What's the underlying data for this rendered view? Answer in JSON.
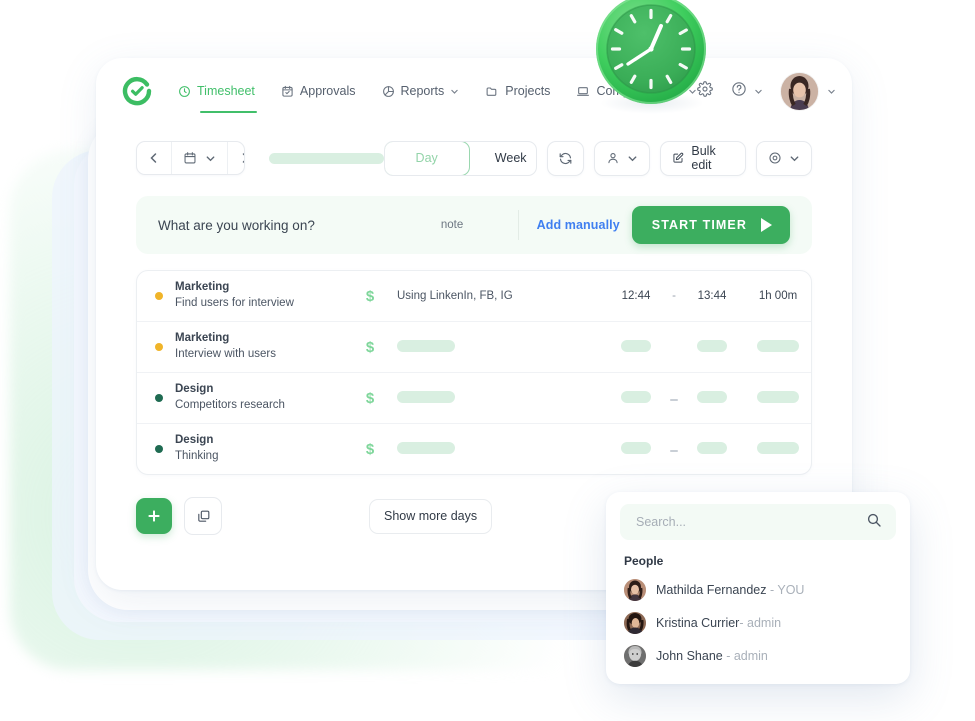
{
  "brand": {
    "logo_icon": "check-circle-logo",
    "accent_green": "#3cae5f",
    "nav_active_green": "#41bf6a",
    "link_blue": "#3f7ff0",
    "marketing_dot": "#f0b429",
    "design_dot": "#1f6b52",
    "skeleton_green": "#d9efe1"
  },
  "nav": {
    "items": [
      {
        "label": "Timesheet",
        "icon": "clock-icon",
        "active": true,
        "caret": false
      },
      {
        "label": "Approvals",
        "icon": "calendar-check-icon",
        "active": false,
        "caret": false
      },
      {
        "label": "Reports",
        "icon": "pie-chart-icon",
        "active": false,
        "caret": true
      },
      {
        "label": "Projects",
        "icon": "folder-icon",
        "active": false,
        "caret": false
      },
      {
        "label": "Computer Time",
        "icon": "laptop-icon",
        "active": false,
        "caret": true
      }
    ],
    "right": {
      "settings_icon": "gear-icon",
      "help_icon": "question-circle-icon",
      "help_caret": "chevron-down-icon",
      "avatar": "user-avatar",
      "avatar_caret": "chevron-down-icon"
    }
  },
  "toolbar": {
    "prev_icon": "chevron-left-icon",
    "calendar_icon": "calendar-icon",
    "calendar_caret": "chevron-down-icon",
    "next_icon": "chevron-right-icon",
    "date_placeholder": "",
    "day_label": "Day",
    "week_label": "Week",
    "refresh_icon": "refresh-icon",
    "user_icon": "user-icon",
    "user_caret": "chevron-down-icon",
    "bulk_edit_label": "Bulk edit",
    "bulk_edit_icon": "edit-square-icon",
    "settings_icon": "gear-icon",
    "settings_caret": "chevron-down-icon"
  },
  "timer": {
    "task_placeholder": "What are you working on?",
    "note_label": "note",
    "add_manually_label": "Add manually",
    "start_label": "START TIMER",
    "play_icon": "play-icon"
  },
  "entries": {
    "rows": [
      {
        "dot": "amber",
        "project": "Marketing",
        "description": "Find users for interview",
        "billable": "$",
        "note": "Using LinkenIn, FB, IG",
        "start": "12:44",
        "dash": "-",
        "end": "13:44",
        "duration": "1h 00m",
        "loading": false
      },
      {
        "dot": "amber",
        "project": "Marketing",
        "description": "Interview with users",
        "billable": "$",
        "note": "",
        "start": "",
        "dash": "",
        "end": "",
        "duration": "",
        "loading": true
      },
      {
        "dot": "green",
        "project": "Design",
        "description": "Competitors research",
        "billable": "$",
        "note": "",
        "start": "",
        "dash": "-",
        "end": "",
        "duration": "",
        "loading": true
      },
      {
        "dot": "green",
        "project": "Design",
        "description": "Thinking",
        "billable": "$",
        "note": "",
        "start": "",
        "dash": "-",
        "end": "",
        "duration": "",
        "loading": true
      }
    ]
  },
  "bottom": {
    "add_icon": "plus-icon",
    "duplicate_icon": "copy-icon",
    "show_more_label": "Show more days"
  },
  "people_popover": {
    "search_placeholder": "Search...",
    "search_icon": "search-icon",
    "section_title": "People",
    "items": [
      {
        "name": "Mathilda Fernandez",
        "separator": " - ",
        "role": "YOU",
        "avatar": "avatar-mathilda"
      },
      {
        "name": "Kristina Currier",
        "separator": "- ",
        "role": "admin",
        "avatar": "avatar-kristina"
      },
      {
        "name": "John Shane",
        "separator": " - ",
        "role": "admin",
        "avatar": "avatar-john"
      }
    ]
  },
  "decor": {
    "clock_icon": "analog-clock-illustration"
  }
}
